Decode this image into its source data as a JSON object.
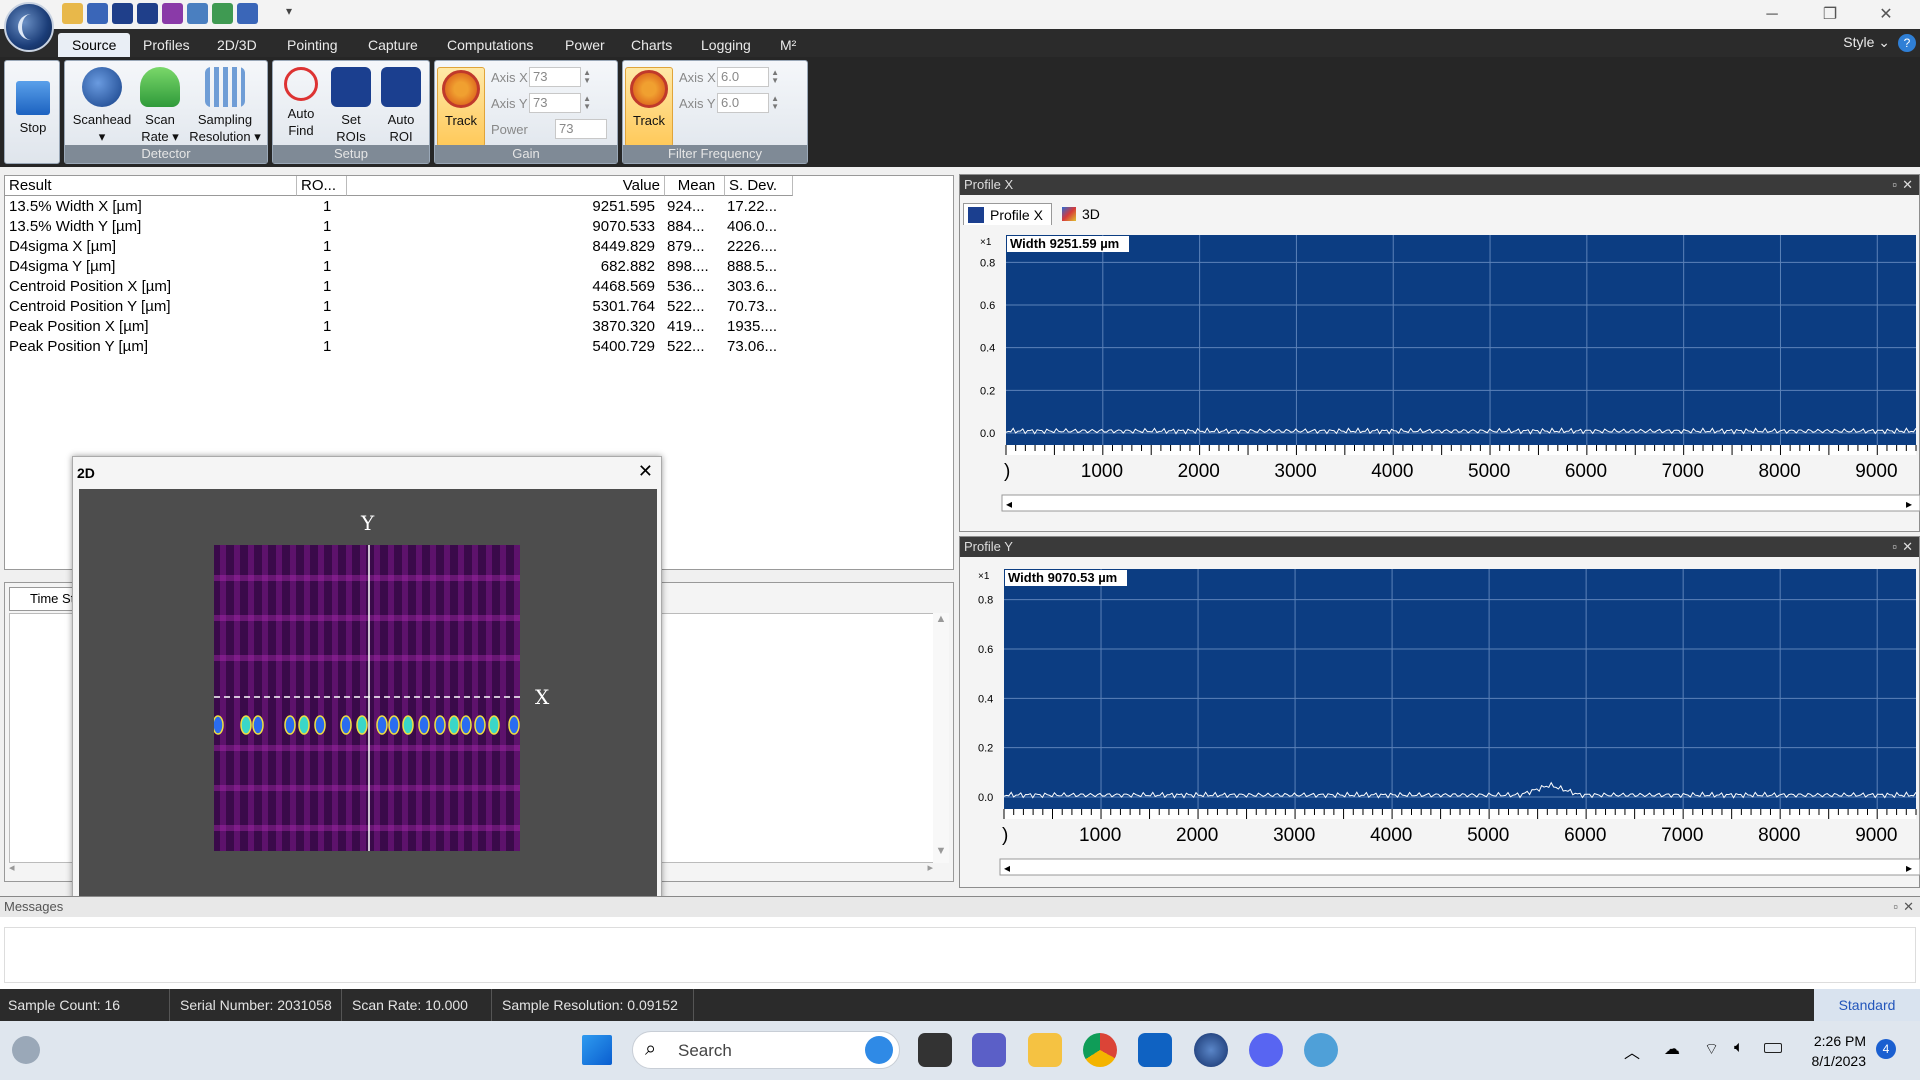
{
  "ribbon_tabs": [
    "Source",
    "Profiles",
    "2D/3D",
    "Pointing",
    "Capture",
    "Computations",
    "Power",
    "Charts",
    "Logging",
    "M²"
  ],
  "style_menu": "Style",
  "ribbon": {
    "stop": "Stop",
    "scanhead": "Scanhead",
    "scan_rate_1": "Scan",
    "scan_rate_2": "Rate",
    "sampling_1": "Sampling",
    "sampling_2": "Resolution",
    "detector_group": "Detector",
    "auto_find_1": "Auto",
    "auto_find_2": "Find",
    "set_rois_1": "Set",
    "set_rois_2": "ROIs",
    "auto_roi_1": "Auto",
    "auto_roi_2": "ROI",
    "setup_group": "Setup",
    "track": "Track",
    "gain_axis_x_label": "Axis X",
    "gain_axis_x": "73",
    "gain_axis_y_label": "Axis Y",
    "gain_axis_y": "73",
    "gain_power_label": "Power",
    "gain_power": "73",
    "gain_group": "Gain",
    "ff_axis_x_label": "Axis X",
    "ff_axis_x": "6.0",
    "ff_axis_y_label": "Axis Y",
    "ff_axis_y": "6.0",
    "filter_group": "Filter Frequency"
  },
  "results": {
    "headers": [
      "Result",
      "RO...",
      "Value",
      "Mean",
      "S. Dev."
    ],
    "rows": [
      [
        "13.5% Width X [µm]",
        "1",
        "9251.595",
        "924...",
        "17.22..."
      ],
      [
        "13.5% Width Y [µm]",
        "1",
        "9070.533",
        "884...",
        "406.0..."
      ],
      [
        "D4sigma X [µm]",
        "1",
        "8449.829",
        "879...",
        "2226...."
      ],
      [
        "D4sigma Y [µm]",
        "1",
        "682.882",
        "898....",
        "888.5..."
      ],
      [
        "Centroid Position X [µm]",
        "1",
        "4468.569",
        "536...",
        "303.6..."
      ],
      [
        "Centroid Position Y [µm]",
        "1",
        "5301.764",
        "522...",
        "70.73..."
      ],
      [
        "Peak Position X [µm]",
        "1",
        "3870.320",
        "419...",
        "1935...."
      ],
      [
        "Peak Position Y [µm]",
        "1",
        "5400.729",
        "522...",
        "73.06..."
      ]
    ]
  },
  "time_tab": "Time St",
  "win2d": {
    "title": "2D",
    "y_label": "Y",
    "x_label": "X"
  },
  "profile_x": {
    "panel_title": "Profile X",
    "tab1": "Profile X",
    "tab2": "3D",
    "multiplier": "×1",
    "width_label": "Width 9251.59 µm",
    "y_ticks": [
      "0.8",
      "0.6",
      "0.4",
      "0.2",
      "0.0"
    ],
    "x_ticks": [
      ")",
      "1000",
      "2000",
      "3000",
      "4000",
      "5000",
      "6000",
      "7000",
      "8000",
      "9000"
    ]
  },
  "profile_y": {
    "panel_title": "Profile Y",
    "multiplier": "×1",
    "width_label": "Width 9070.53 µm",
    "y_ticks": [
      "0.8",
      "0.6",
      "0.4",
      "0.2",
      "0.0"
    ],
    "x_ticks": [
      ")",
      "1000",
      "2000",
      "3000",
      "4000",
      "5000",
      "6000",
      "7000",
      "8000",
      "9000"
    ]
  },
  "messages_title": "Messages",
  "status": {
    "sample_count": "Sample Count: 16",
    "serial": "Serial Number: 2031058",
    "scan_rate": "Scan Rate: 10.000 Hz",
    "sample_res": "Sample Resolution: 0.09152",
    "mode": "Standard"
  },
  "taskbar": {
    "search": "Search",
    "time": "2:26 PM",
    "date": "8/1/2023",
    "notifications": "4"
  },
  "colors": {
    "plot_bg": "#0c3d82",
    "ribbon_dark": "#262626",
    "accent_track": "#ffc95a"
  }
}
